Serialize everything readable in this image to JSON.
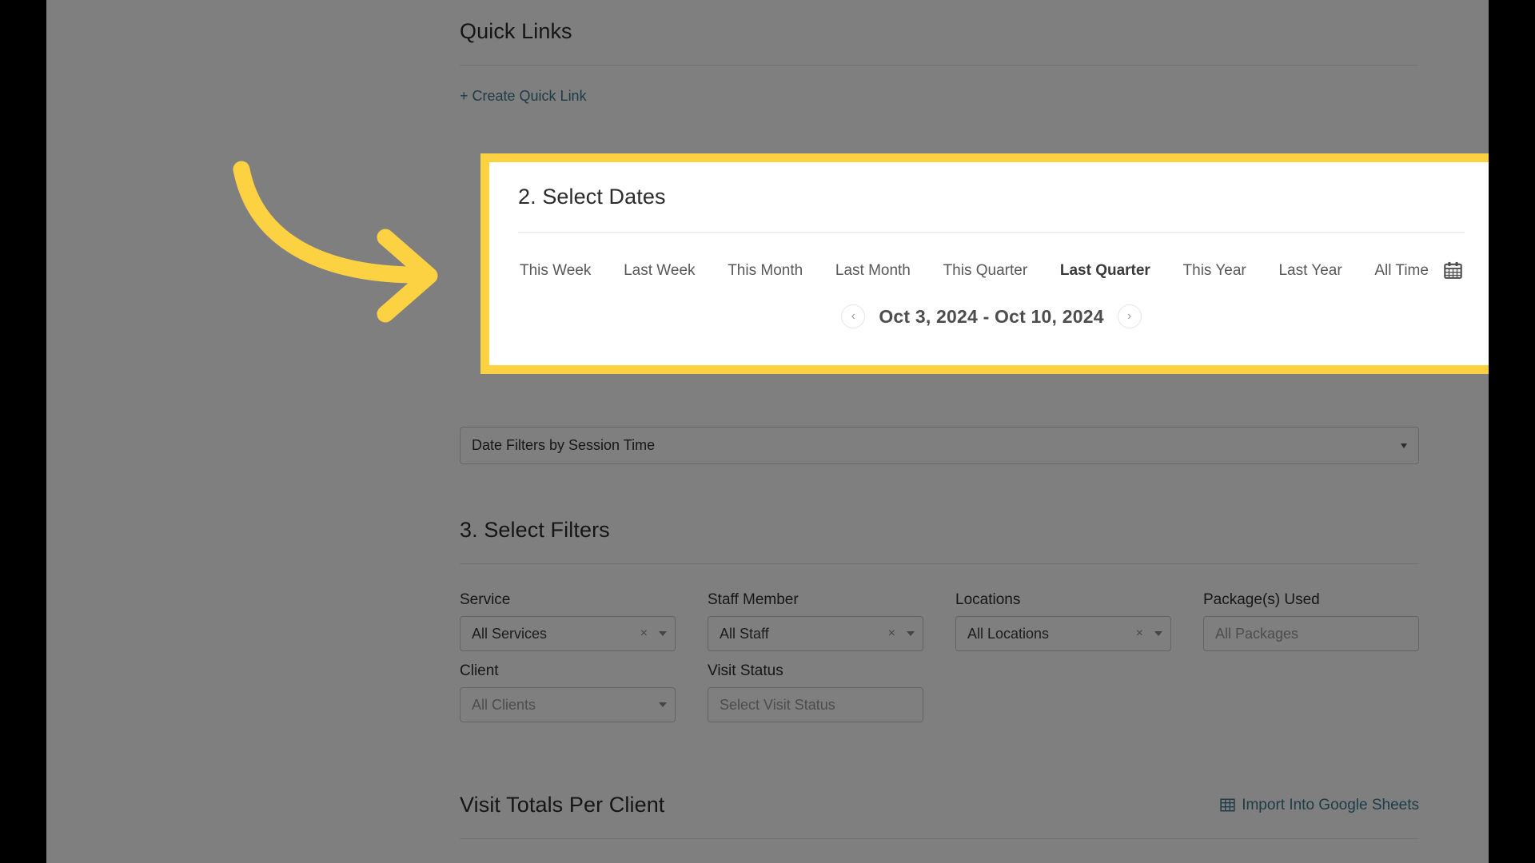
{
  "theme": {
    "highlight_yellow": "#fcd142",
    "teal_link": "#3d788e",
    "letterbox_black": "#000000",
    "dim_gray": "#808080"
  },
  "quick_links": {
    "title": "Quick Links",
    "create_label": "+ Create Quick Link"
  },
  "select_dates": {
    "title": "2. Select Dates",
    "calendar_icon": "calendar-icon",
    "tabs": [
      {
        "label": "This Week",
        "active": false
      },
      {
        "label": "Last Week",
        "active": false
      },
      {
        "label": "This Month",
        "active": false
      },
      {
        "label": "Last Month",
        "active": false
      },
      {
        "label": "This Quarter",
        "active": false
      },
      {
        "label": "Last Quarter",
        "active": true
      },
      {
        "label": "This Year",
        "active": false
      },
      {
        "label": "Last Year",
        "active": false
      },
      {
        "label": "All Time",
        "active": false
      }
    ],
    "range": {
      "prev_icon": "chevron-left-icon",
      "next_icon": "chevron-right-icon",
      "label": "Oct 3, 2024 - Oct 10, 2024",
      "start": "Oct 3, 2024",
      "end": "Oct 10, 2024"
    }
  },
  "session_dropdown": {
    "value": "Date Filters by Session Time",
    "caret_icon": "caret-down-icon"
  },
  "select_filters": {
    "title": "3. Select Filters",
    "fields": [
      {
        "label": "Service",
        "value": "All Services",
        "placeholder": false,
        "clearable": true,
        "caret": true
      },
      {
        "label": "Staff Member",
        "value": "All Staff",
        "placeholder": false,
        "clearable": true,
        "caret": true
      },
      {
        "label": "Locations",
        "value": "All Locations",
        "placeholder": false,
        "clearable": true,
        "caret": true
      },
      {
        "label": "Package(s) Used",
        "value": "All Packages",
        "placeholder": true,
        "clearable": false,
        "caret": false
      },
      {
        "label": "Client",
        "value": "All Clients",
        "placeholder": true,
        "clearable": false,
        "caret": true
      },
      {
        "label": "Visit Status",
        "value": "Select Visit Status",
        "placeholder": true,
        "clearable": false,
        "caret": false
      }
    ]
  },
  "visit_totals": {
    "title": "Visit Totals Per Client",
    "import_label": "Import Into Google Sheets",
    "import_icon": "table-grid-icon"
  },
  "annotation": {
    "arrow_icon": "curved-arrow-right-icon",
    "points_to": "2. Select Dates"
  }
}
